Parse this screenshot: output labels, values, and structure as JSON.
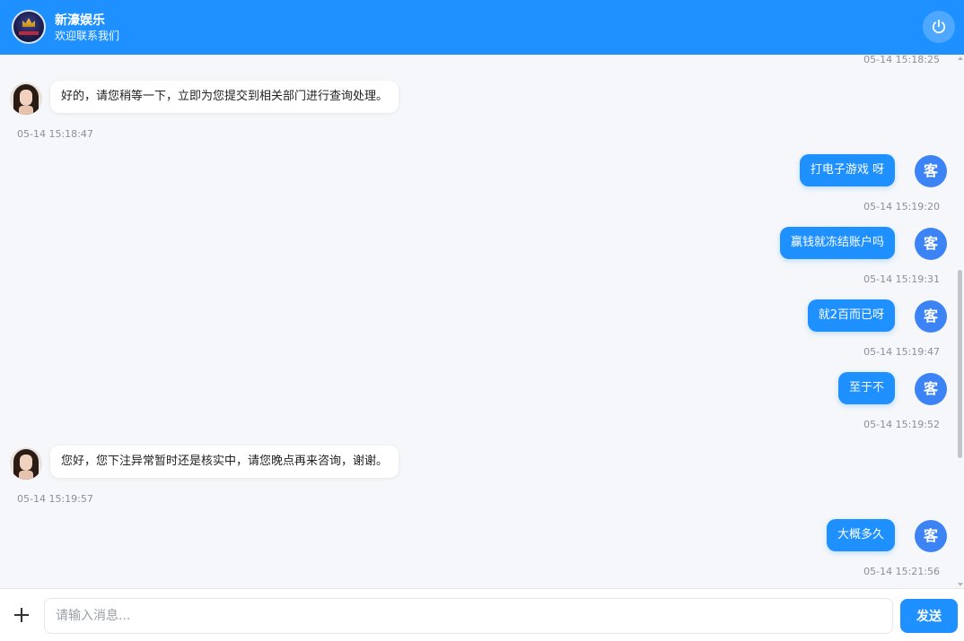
{
  "header": {
    "title": "新濠娱乐",
    "subtitle": "欢迎联系我们",
    "logo_icon": "casino-logo-icon",
    "power_icon": "power-icon",
    "accent_color": "#1e90ff"
  },
  "chat": {
    "top_timestamp": "05-14 15:18:25",
    "messages": [
      {
        "sender": "agent",
        "text": "好的，请您稍等一下，立即为您提交到相关部门进行查询处理。",
        "time": "05-14 15:18:47"
      },
      {
        "sender": "user",
        "avatar_label": "客",
        "text": "打电子游戏 呀",
        "time": "05-14 15:19:20"
      },
      {
        "sender": "user",
        "avatar_label": "客",
        "text": "赢钱就冻结账户吗",
        "time": "05-14 15:19:31"
      },
      {
        "sender": "user",
        "avatar_label": "客",
        "text": "就2百而已呀",
        "time": "05-14 15:19:47"
      },
      {
        "sender": "user",
        "avatar_label": "客",
        "text": "至于不",
        "time": "05-14 15:19:52"
      },
      {
        "sender": "agent",
        "text": "您好，您下注异常暂时还是核实中，请您晚点再来咨询，谢谢。",
        "time": "05-14 15:19:57"
      },
      {
        "sender": "user",
        "avatar_label": "客",
        "text": "大概多久",
        "time": "05-14 15:21:56"
      }
    ]
  },
  "footer": {
    "input_placeholder": "请输入消息...",
    "send_label": "发送",
    "plus_icon": "plus-icon"
  }
}
